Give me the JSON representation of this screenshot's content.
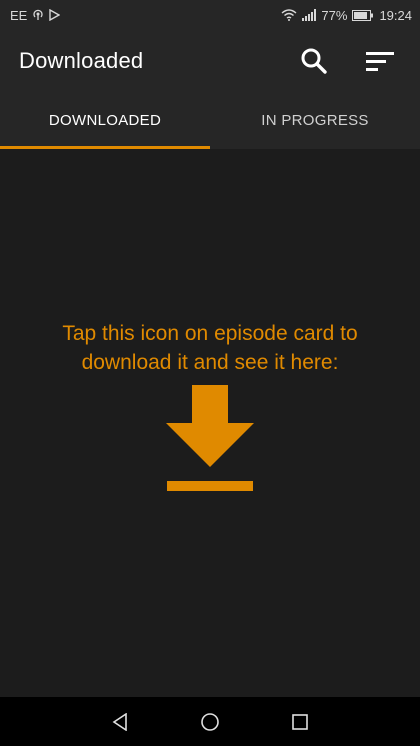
{
  "status_bar": {
    "carrier": "EE",
    "battery_percent": "77%",
    "time": "19:24"
  },
  "app_bar": {
    "title": "Downloaded",
    "actions": [
      "search-icon",
      "sort-icon"
    ]
  },
  "tabs": [
    {
      "label": "DOWNLOADED",
      "selected": true
    },
    {
      "label": "IN PROGRESS",
      "selected": false
    }
  ],
  "empty_state": {
    "message": "Tap this icon on episode card to download it and see it here:",
    "icon": "download-icon"
  },
  "nav_bar": {
    "buttons": [
      "back-icon",
      "home-icon",
      "recents-icon"
    ]
  },
  "colors": {
    "accent": "#e08a00",
    "bar_background": "#262626",
    "content_background": "#1c1c1c"
  }
}
